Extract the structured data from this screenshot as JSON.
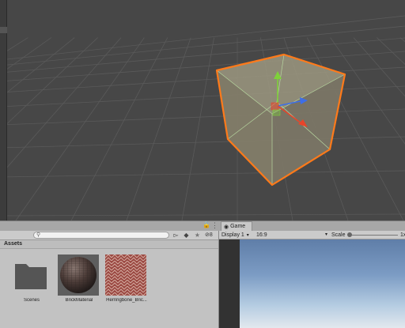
{
  "game_tab": {
    "label": "Game",
    "icon": "game-eye-icon"
  },
  "project": {
    "search": {
      "value": "",
      "placeholder": ""
    },
    "toolbar_icons": [
      "create-icon",
      "label-filter-icon",
      "favorites-star-icon",
      "hidden-packages-icon"
    ],
    "hidden_count": "8",
    "breadcrumb": "Assets",
    "assets": [
      {
        "label": "Scenes",
        "icon": "folder-icon"
      },
      {
        "label": "BrickMaterial",
        "icon": "material-sphere-icon"
      },
      {
        "label": "Herringbone_Bric...",
        "icon": "texture-icon"
      }
    ]
  },
  "game": {
    "display": "Display 1",
    "aspect": "16:9",
    "scale_label": "Scale",
    "scale_value": "1x",
    "scale_level": 0.0
  },
  "colors": {
    "scene_bg": "#474747",
    "selection_outline": "#ff7a1a",
    "cube_fill": "#8e8a75",
    "axis_x": "#e6452b",
    "axis_y": "#7ed13a",
    "axis_z": "#3d6ee8"
  }
}
